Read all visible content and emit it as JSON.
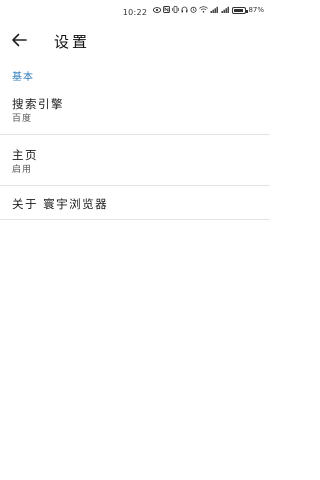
{
  "status_bar": {
    "time": "10:22",
    "icons": [
      "eye-icon",
      "nfc-icon",
      "vibrate-icon",
      "headset-icon",
      "alarm-icon",
      "wifi-icon",
      "signal-icon",
      "signal-icon",
      "battery-icon"
    ],
    "battery_percent": 87,
    "battery_text": "87%"
  },
  "app_bar": {
    "title": "设置",
    "back_icon": "arrow-left-icon"
  },
  "section": {
    "header": "基本"
  },
  "settings": [
    {
      "title": "搜索引擎",
      "subtitle": "百度"
    },
    {
      "title": "主页",
      "subtitle": "启用"
    },
    {
      "title": "关于 寰宇浏览器"
    }
  ],
  "colors": {
    "accent": "#2e7bb8",
    "divider": "#e3e3e3",
    "background": "#ffffff"
  }
}
